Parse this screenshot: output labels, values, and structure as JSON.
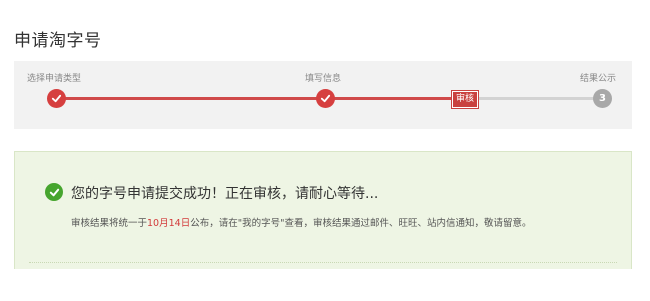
{
  "page": {
    "title": "申请淘字号"
  },
  "steps": [
    {
      "label": "选择申请类型",
      "state": "done"
    },
    {
      "label": "填写信息",
      "state": "done"
    },
    {
      "label": "审核",
      "state": "current"
    },
    {
      "label": "结果公示",
      "state": "pending",
      "number": "3"
    }
  ],
  "result": {
    "title": "您的字号申请提交成功！正在审核，请耐心等待...",
    "detail_before": "审核结果将统一于",
    "detail_date": "10月14日",
    "detail_after": "公布，请在\"我的字号\"查看，审核结果通过邮件、旺旺、站内信通知，敬请留意。"
  },
  "colors": {
    "accent": "#d04a4a",
    "success": "#46a52e",
    "panel_green": "#eef5e4"
  }
}
